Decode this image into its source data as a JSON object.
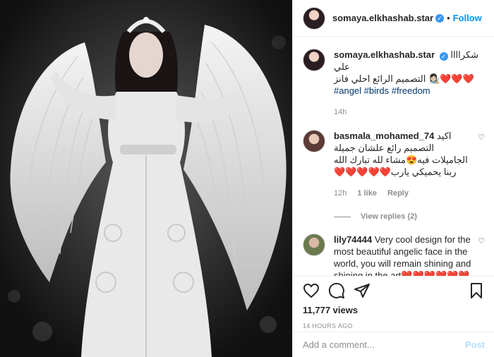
{
  "header": {
    "username": "somaya.elkhashab.star",
    "separator": "•",
    "follow_label": "Follow",
    "verified_glyph": "✓"
  },
  "caption": {
    "username": "somaya.elkhashab.star",
    "text_line1": "شكراااا علي",
    "text_line2": "❤️❤️❤️👩🏻‍🎨 التصميم الرائع احلي فانز",
    "hashtags": [
      "#angel",
      "#birds",
      "#freedom"
    ],
    "time": "14h"
  },
  "comments": [
    {
      "username": "basmala_mohamed_74",
      "text_prefix": "اكيد",
      "text": "التصميم رائع علشان جميلة الجاميلات فيه😍مشاء لله تبارك الله ربنا يحميكي يارب❤️❤️❤️❤️❤️",
      "time": "12h",
      "likes": "1 like",
      "reply": "Reply",
      "view_replies": "View replies (2)"
    },
    {
      "username": "lily74444",
      "text": "Very cool design for the most beautiful angelic face in the world, you will remain shining and shining in the art❤️❤️❤️❤️❤️❤️❤️❤️ ❤️💋❤️"
    }
  ],
  "actions": {
    "views": "11,777 views",
    "time_ago": "14 HOURS AGO",
    "icons": [
      "heart-icon",
      "comment-icon",
      "share-icon",
      "bookmark-icon"
    ]
  },
  "add_comment": {
    "placeholder": "Add a comment...",
    "post_label": "Post"
  },
  "colors": {
    "link_blue": "#0095f6",
    "hashtag": "#00376b",
    "muted": "#8e8e8e",
    "post_disabled": "#b2dffc",
    "heart_red": "#ed4956"
  }
}
